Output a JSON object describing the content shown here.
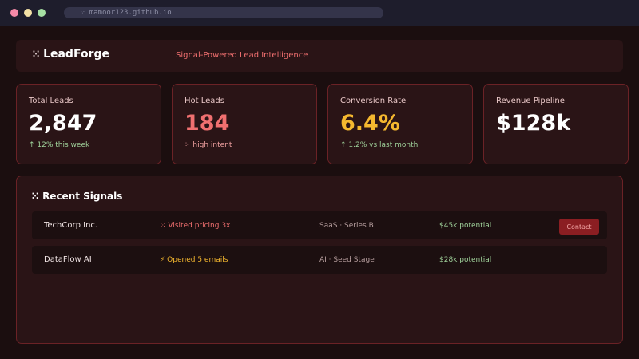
{
  "browser": {
    "url": "mamoor123.github.io",
    "lock_icon": "lock-icon"
  },
  "header": {
    "logo_icon": "⁙",
    "brand": "LeadForge",
    "tagline": "Signal-Powered Lead Intelligence"
  },
  "stats": [
    {
      "label": "Total Leads",
      "value": "2,847",
      "sub": "↑ 12% this week",
      "value_color": "#ffffff",
      "sub_color": "#9fd19a"
    },
    {
      "label": "Hot Leads",
      "value": "184",
      "sub": "⁙ high intent",
      "value_color": "#f07070",
      "sub_color": "#f0a0a0"
    },
    {
      "label": "Conversion Rate",
      "value": "6.4%",
      "sub": "↑ 1.2% vs last month",
      "value_color": "#f5b82f",
      "sub_color": "#9fd19a"
    },
    {
      "label": "Revenue Pipeline",
      "value": "$128k",
      "sub": "",
      "value_color": "#ffffff",
      "sub_color": "#9fd19a"
    }
  ],
  "signals": {
    "title_icon": "⁙",
    "title": "Recent Signals",
    "rows": [
      {
        "company": "TechCorp Inc.",
        "signal": "⁙ Visited pricing 3x",
        "signal_color": "#ef6f6f",
        "segment": "SaaS · Series B",
        "potential": "$45k potential",
        "action": "Contact"
      },
      {
        "company": "DataFlow AI",
        "signal": "⚡ Opened 5 emails",
        "signal_color": "#f5b82f",
        "segment": "AI · Seed Stage",
        "potential": "$28k potential",
        "action": ""
      }
    ]
  }
}
